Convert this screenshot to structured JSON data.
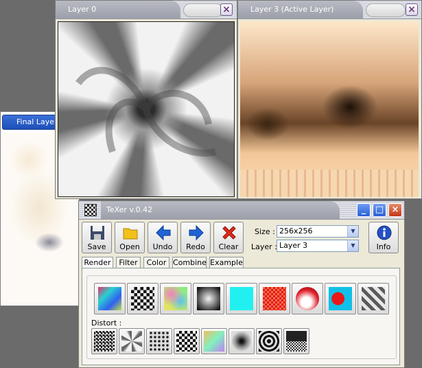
{
  "final_layer_window": {
    "title": "Final Layer"
  },
  "layer0_window": {
    "title": "Layer 0"
  },
  "layer3_window": {
    "title": "Layer 3 (Active Layer)"
  },
  "texer_window": {
    "title": "TeXer v.0.42"
  },
  "toolbar": {
    "save_label": "Save",
    "open_label": "Open",
    "undo_label": "Undo",
    "redo_label": "Redo",
    "clear_label": "Clear",
    "info_label": "Info"
  },
  "size": {
    "label": "Size :",
    "value": "256x256"
  },
  "layer": {
    "label": "Layer :",
    "value": "Layer 3"
  },
  "tabs": [
    "Render",
    "Filter",
    "Color",
    "Combine",
    "Example"
  ],
  "distort_label": "Distort :",
  "icons": {
    "close": "close-icon",
    "save": "floppy-disk-icon",
    "open": "folder-icon",
    "undo": "left-arrow-icon",
    "redo": "right-arrow-icon",
    "clear": "red-x-icon",
    "info": "info-icon"
  }
}
